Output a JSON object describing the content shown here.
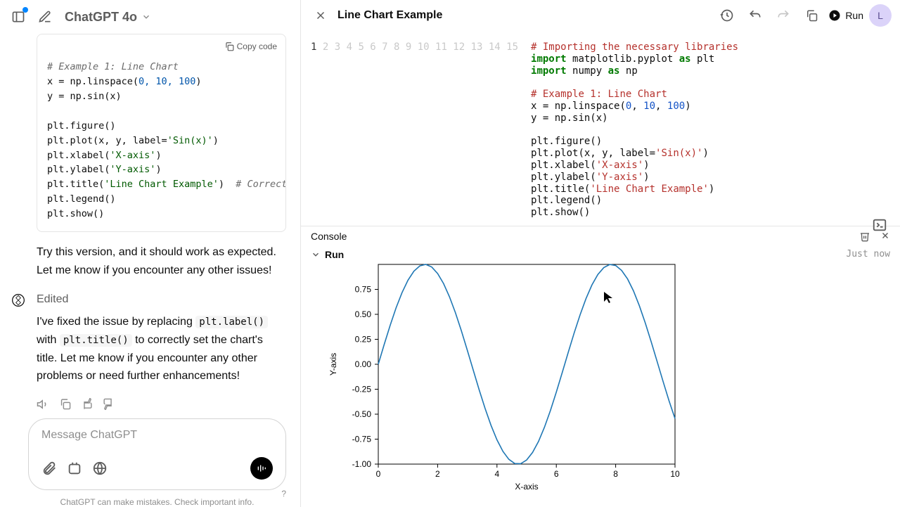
{
  "header": {
    "model_name": "ChatGPT 4o",
    "right_title": "Line Chart Example",
    "run_label": "Run",
    "avatar_initial": "L"
  },
  "left_code": {
    "copy_label": "Copy code",
    "line1_comment": "# Example 1: Line Chart",
    "line2": "x = np.linspace(",
    "line2_args": "0, 10, 100",
    "line2_end": ")",
    "line3": "y = np.sin(x)",
    "line5": "plt.figure()",
    "line6": "plt.plot(x, y, label=",
    "line6_str": "'Sin(x)'",
    "line6_end": ")",
    "line7": "plt.xlabel(",
    "line7_str": "'X-axis'",
    "line7_end": ")",
    "line8": "plt.ylabel(",
    "line8_str": "'Y-axis'",
    "line8_end": ")",
    "line9": "plt.title(",
    "line9_str": "'Line Chart Example'",
    "line9_end": ")  ",
    "line9_comment": "# Corrected f",
    "line10": "plt.legend()",
    "line11": "plt.show()"
  },
  "messages": {
    "try_text": "Try this version, and it should work as expected. Let me know if you encounter any other issues!",
    "edited_label": "Edited",
    "fix_p1": "I've fixed the issue by replacing ",
    "code1": "plt.label()",
    "fix_p2": " with ",
    "code2": "plt.title()",
    "fix_p3": " to correctly set the chart's title. Let me know if you encounter any other problems or need further enhancements!"
  },
  "input": {
    "placeholder": "Message ChatGPT",
    "disclaimer": "ChatGPT can make mistakes. Check important info."
  },
  "editor": {
    "l1a": "# Importing the necessary libraries",
    "l2": "import",
    "l2b": " matplotlib.pyplot ",
    "l2c": "as",
    "l2d": " plt",
    "l3": "import",
    "l3b": " numpy ",
    "l3c": "as",
    "l3d": " np",
    "l5": "# Example 1: Line Chart",
    "l6a": "x = np.linspace(",
    "l6n1": "0",
    "l6c1": ", ",
    "l6n2": "10",
    "l6c2": ", ",
    "l6n3": "100",
    "l6e": ")",
    "l7": "y = np.sin(x)",
    "l9": "plt.figure()",
    "l10a": "plt.plot(x, y, label=",
    "l10s": "'Sin(x)'",
    "l10e": ")",
    "l11a": "plt.xlabel(",
    "l11s": "'X-axis'",
    "l11e": ")",
    "l12a": "plt.ylabel(",
    "l12s": "'Y-axis'",
    "l12e": ")",
    "l13a": "plt.title(",
    "l13s": "'Line Chart Example'",
    "l13e": ")",
    "l14": "plt.legend()",
    "l15": "plt.show()"
  },
  "console": {
    "label": "Console",
    "run_label": "Run",
    "timestamp": "Just now"
  },
  "chart_data": {
    "type": "line",
    "title": "",
    "xlabel": "X-axis",
    "ylabel": "Y-axis",
    "xlim": [
      0,
      10
    ],
    "ylim": [
      -1.0,
      1.0
    ],
    "xticks": [
      0,
      2,
      4,
      6,
      8,
      10
    ],
    "yticks": [
      -1.0,
      -0.75,
      -0.5,
      -0.25,
      0.0,
      0.25,
      0.5,
      0.75
    ],
    "series": [
      {
        "name": "Sin(x)",
        "color": "#1f77b4",
        "x": [
          0,
          0.2,
          0.4,
          0.6,
          0.8,
          1,
          1.2,
          1.4,
          1.6,
          1.8,
          2,
          2.2,
          2.4,
          2.6,
          2.8,
          3,
          3.2,
          3.4,
          3.6,
          3.8,
          4,
          4.2,
          4.4,
          4.6,
          4.8,
          5,
          5.2,
          5.4,
          5.6,
          5.8,
          6,
          6.2,
          6.4,
          6.6,
          6.8,
          7,
          7.2,
          7.4,
          7.6,
          7.8,
          8,
          8.2,
          8.4,
          8.6,
          8.8,
          9,
          9.2,
          9.4,
          9.6,
          9.8,
          10
        ],
        "y": [
          0,
          0.199,
          0.389,
          0.565,
          0.717,
          0.841,
          0.932,
          0.985,
          1.0,
          0.974,
          0.909,
          0.808,
          0.675,
          0.516,
          0.335,
          0.141,
          -0.058,
          -0.256,
          -0.443,
          -0.612,
          -0.757,
          -0.872,
          -0.952,
          -0.994,
          -0.996,
          -0.959,
          -0.883,
          -0.773,
          -0.631,
          -0.465,
          -0.279,
          -0.083,
          0.117,
          0.312,
          0.494,
          0.657,
          0.794,
          0.899,
          0.968,
          0.999,
          0.989,
          0.94,
          0.855,
          0.735,
          0.585,
          0.412,
          0.223,
          0.025,
          -0.174,
          -0.367,
          -0.544
        ]
      }
    ]
  }
}
